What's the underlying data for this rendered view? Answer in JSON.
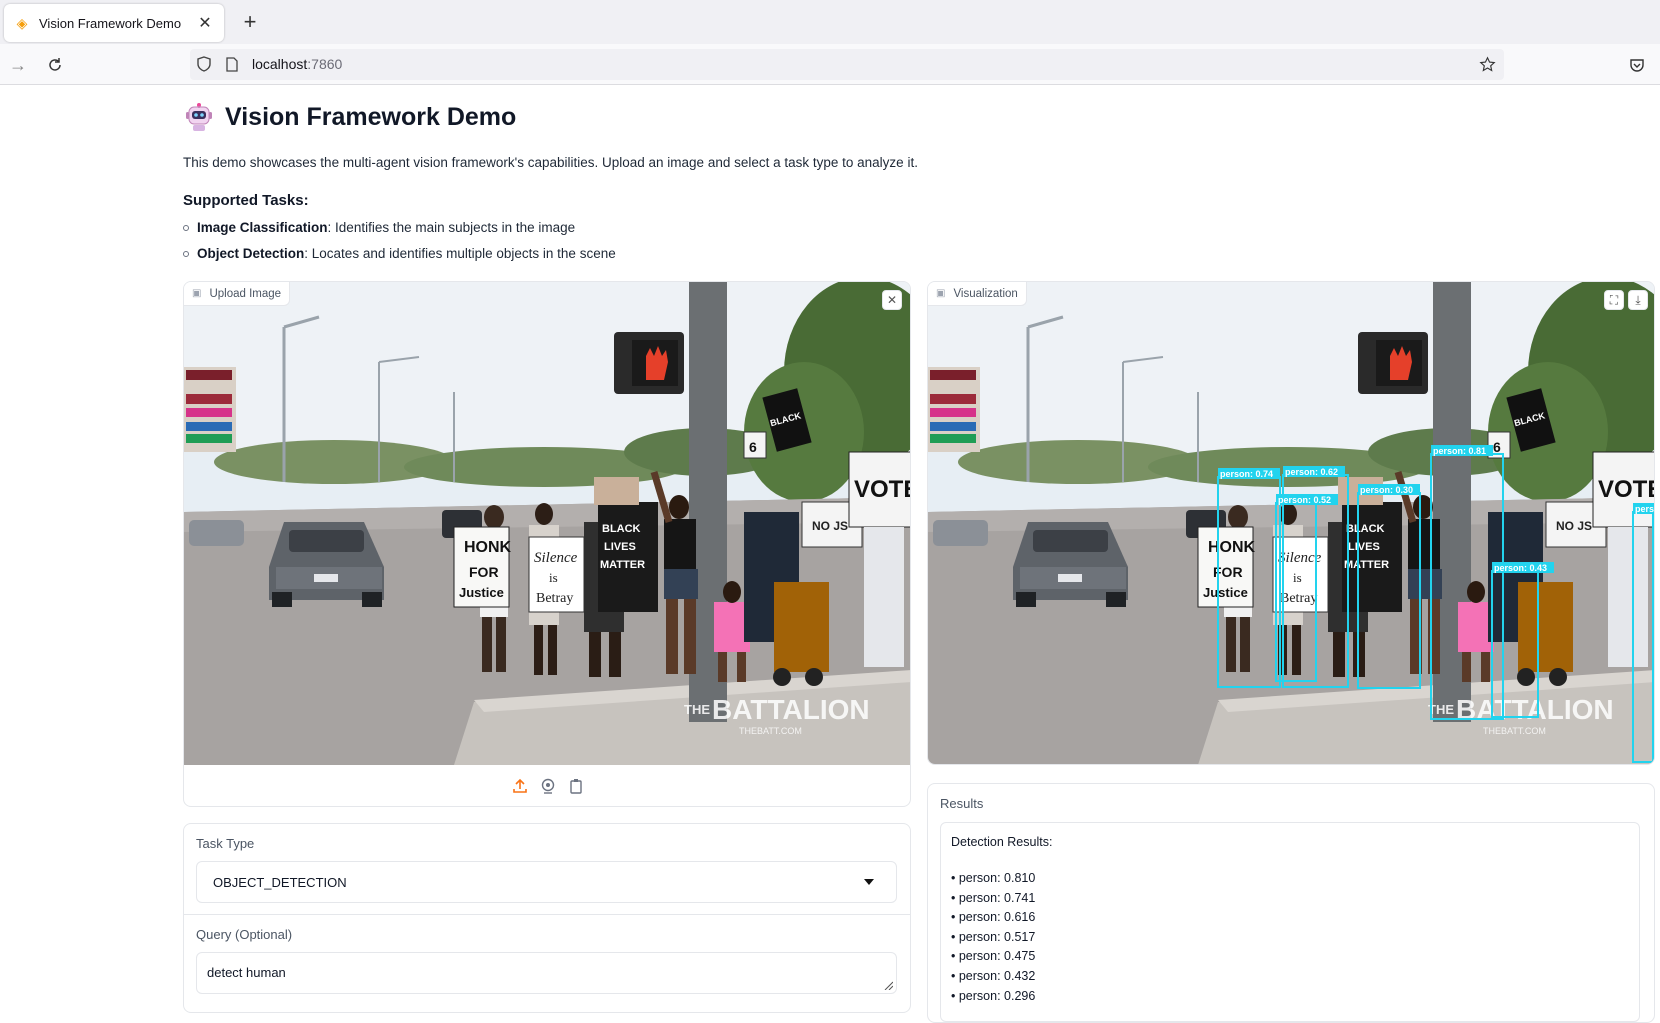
{
  "browser": {
    "tab_title": "Vision Framework Demo",
    "url_host": "localhost",
    "url_port": ":7860"
  },
  "page": {
    "title": "Vision Framework Demo",
    "description": "This demo showcases the multi-agent vision framework's capabilities. Upload an image and select a task type to analyze it.",
    "tasks_heading": "Supported Tasks:",
    "tasks": [
      {
        "name": "Image Classification",
        "text": ": Identifies the main subjects in the image"
      },
      {
        "name": "Object Detection",
        "text": ": Locates and identifies multiple objects in the scene"
      }
    ]
  },
  "upload": {
    "label": "Upload Image",
    "watermark_main": "BATTALION",
    "watermark_prefix": "THE",
    "watermark_sub": "THEBATT.COM"
  },
  "visualization": {
    "label": "Visualization",
    "boxes": [
      {
        "label": "person: 0.74"
      },
      {
        "label": "person: 0.62"
      },
      {
        "label": "person: 0.52"
      },
      {
        "label": "person: 0.30"
      },
      {
        "label": "person: 0.81"
      },
      {
        "label": "person: 0.43"
      },
      {
        "label": "person"
      }
    ],
    "box_color": "#22d3ee"
  },
  "task_type": {
    "label": "Task Type",
    "value": "OBJECT_DETECTION"
  },
  "query": {
    "label": "Query (Optional)",
    "value": "detect human"
  },
  "results": {
    "label": "Results",
    "title": "Detection Results:",
    "lines": [
      "• person: 0.810",
      "• person: 0.741",
      "• person: 0.616",
      "• person: 0.517",
      "• person: 0.475",
      "• person: 0.432",
      "• person: 0.296"
    ]
  },
  "colors": {
    "accent": "#f97316",
    "detection": "#22d3ee"
  }
}
